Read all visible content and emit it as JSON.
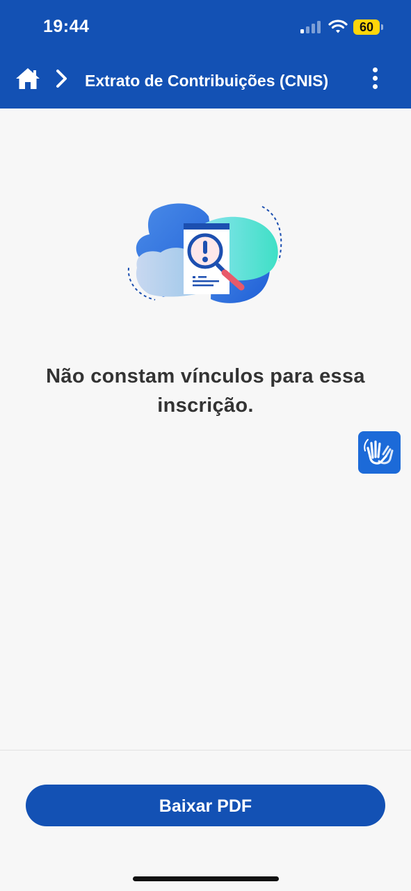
{
  "status_bar": {
    "time": "19:44",
    "battery": "60",
    "icons": [
      "cellular-signal-icon",
      "wifi-icon",
      "battery-icon"
    ]
  },
  "header": {
    "title": "Extrato de Contribuições (CNIS)",
    "icons": [
      "home-icon",
      "chevron-right-icon",
      "more-vertical-icon"
    ]
  },
  "main": {
    "message": "Não constam vínculos para essa inscrição.",
    "illustration_icon": "document-magnifier-alert-icon",
    "libras_icon": "sign-language-hands-icon"
  },
  "footer": {
    "download_label": "Baixar PDF"
  },
  "colors": {
    "brand_blue": "#1351b4",
    "background": "#f7f7f7",
    "battery_yellow": "#ffd60a",
    "libras_blue": "#1c6ad8"
  }
}
